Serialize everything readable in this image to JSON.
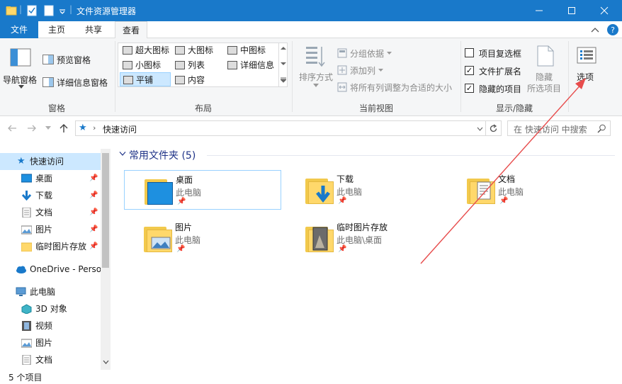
{
  "window": {
    "title": "文件资源管理器",
    "accent": "#1979ca"
  },
  "tabs": [
    {
      "label": "文件"
    },
    {
      "label": "主页"
    },
    {
      "label": "共享"
    },
    {
      "label": "查看"
    }
  ],
  "ribbon": {
    "pane_group": {
      "nav_pane": "导航窗格",
      "preview_pane": "预览窗格",
      "details_pane": "详细信息窗格",
      "label": "窗格"
    },
    "layout_group": {
      "items": [
        "超大图标",
        "大图标",
        "中图标",
        "小图标",
        "列表",
        "详细信息",
        "平铺",
        "内容"
      ],
      "selected": "平铺",
      "label": "布局"
    },
    "current_view_group": {
      "sort_by": "排序方式",
      "group_by": "分组依据",
      "add_column": "添加列",
      "fit_columns": "将所有列调整为合适的大小",
      "label": "当前视图"
    },
    "show_hide_group": {
      "item_checkboxes": {
        "label": "项目复选框",
        "checked": false
      },
      "file_extensions": {
        "label": "文件扩展名",
        "checked": true
      },
      "hidden_items": {
        "label": "隐藏的项目",
        "checked": true
      },
      "hide_selected_1": "隐藏",
      "hide_selected_2": "所选项目",
      "label": "显示/隐藏"
    },
    "options": "选项"
  },
  "address": {
    "path": "快速访问",
    "search_placeholder": "在 快速访问 中搜索"
  },
  "nav": {
    "quick_access": "快速访问",
    "quick_items": [
      "桌面",
      "下载",
      "文档",
      "图片",
      "临时图片存放"
    ],
    "onedrive": "OneDrive - Perso",
    "this_pc": "此电脑",
    "pc_items": [
      "3D 对象",
      "视频",
      "图片",
      "文档"
    ]
  },
  "content": {
    "section": "常用文件夹 (5)",
    "folders": [
      {
        "name": "桌面",
        "location": "此电脑"
      },
      {
        "name": "下载",
        "location": "此电脑"
      },
      {
        "name": "文档",
        "location": "此电脑"
      },
      {
        "name": "图片",
        "location": "此电脑"
      },
      {
        "name": "临时图片存放",
        "location": "此电脑\\桌面"
      }
    ]
  },
  "status": {
    "count": "5 个项目"
  }
}
